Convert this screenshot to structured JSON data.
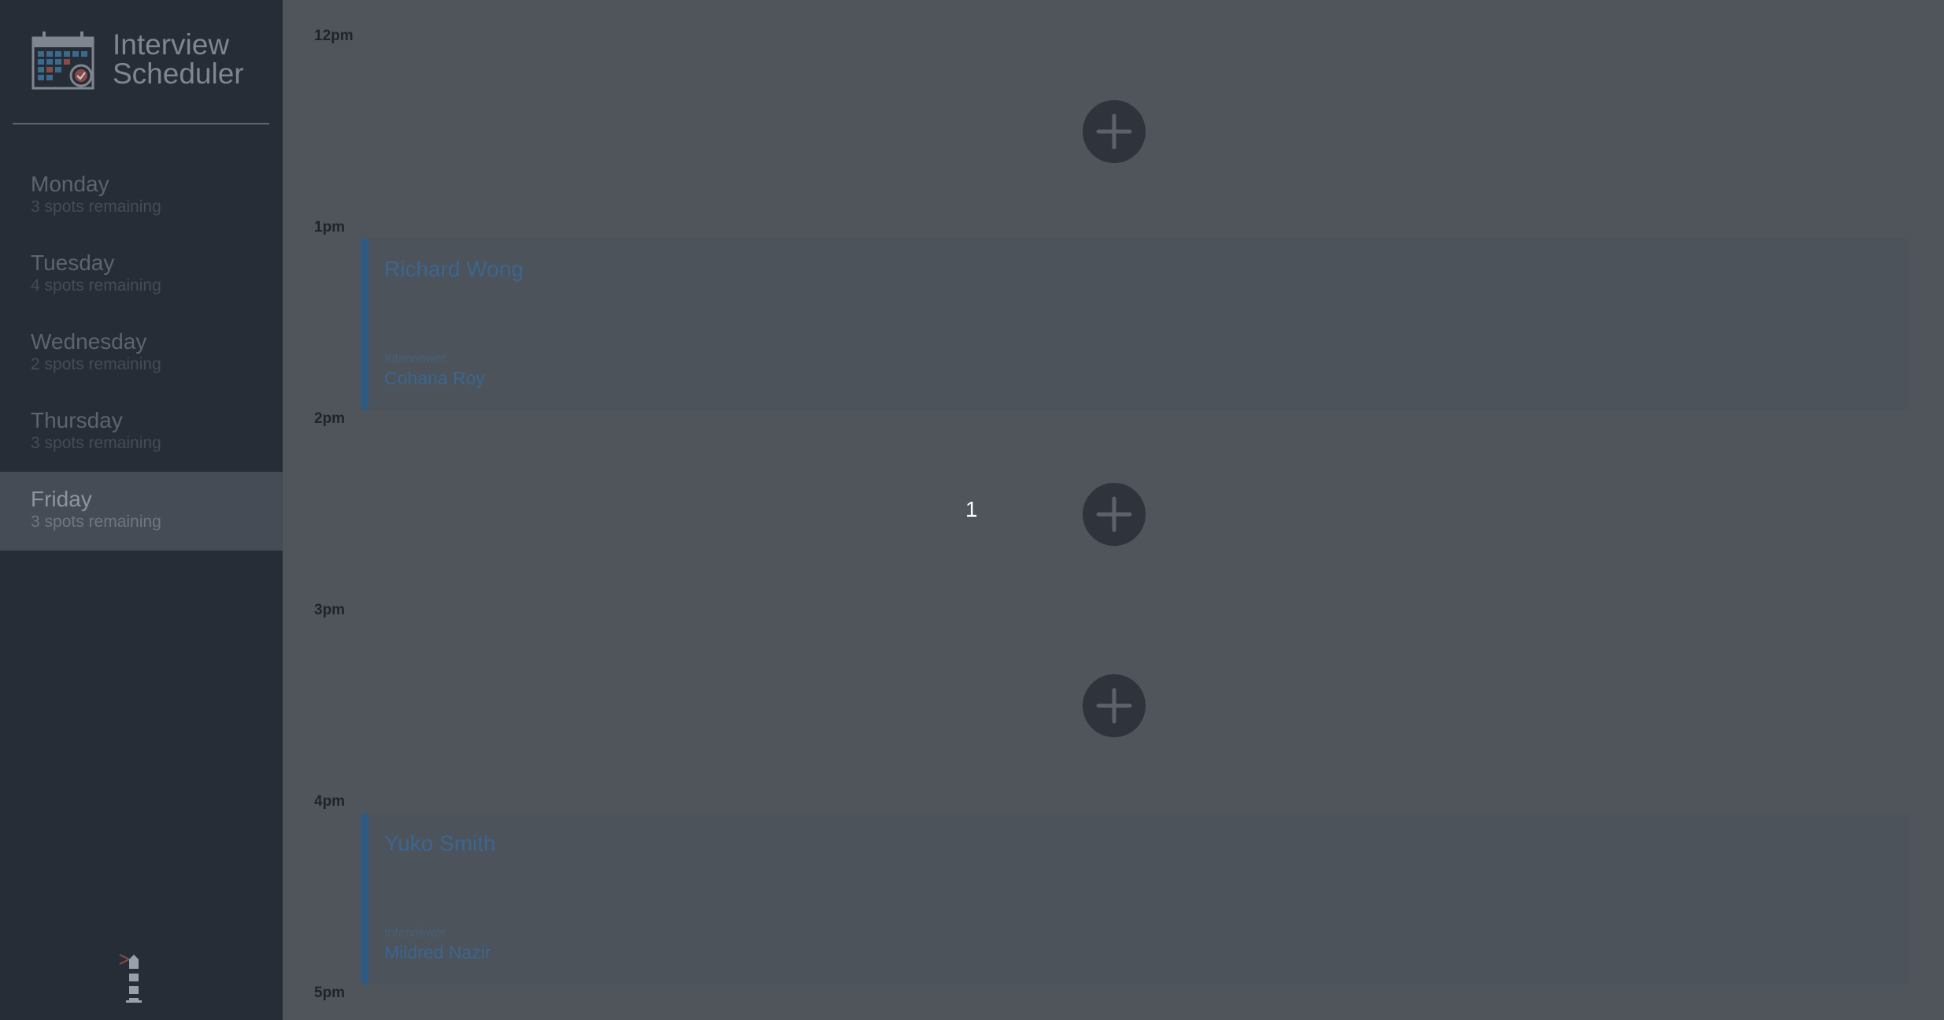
{
  "brand": {
    "title_line1": "Interview",
    "title_line2": "Scheduler",
    "logo_icon": "calendar-icon"
  },
  "days": [
    {
      "name": "Monday",
      "spots": "3 spots remaining",
      "selected": false
    },
    {
      "name": "Tuesday",
      "spots": "4 spots remaining",
      "selected": false
    },
    {
      "name": "Wednesday",
      "spots": "2 spots remaining",
      "selected": false
    },
    {
      "name": "Thursday",
      "spots": "3 spots remaining",
      "selected": false
    },
    {
      "name": "Friday",
      "spots": "3 spots remaining",
      "selected": true
    }
  ],
  "footer_icon": "lighthouse-icon",
  "schedule": {
    "slots": [
      {
        "time": "12pm",
        "status": "empty",
        "add_icon": "plus-icon"
      },
      {
        "time": "1pm",
        "status": "booked",
        "student": "Richard Wong",
        "interviewer_label": "Interviewer",
        "interviewer": "Cohana Roy"
      },
      {
        "time": "2pm",
        "status": "empty",
        "add_icon": "plus-icon"
      },
      {
        "time": "3pm",
        "status": "empty",
        "add_icon": "plus-icon"
      },
      {
        "time": "4pm",
        "status": "booked",
        "student": "Yuko Smith",
        "interviewer_label": "Interviewer",
        "interviewer": "Mildred Nazir"
      }
    ],
    "end_time": "5pm"
  },
  "overlay_number": "1",
  "colors": {
    "sidebar_bg": "#262d36",
    "main_bg": "#50555c",
    "selected_day_bg": "#454c55",
    "appointment_accent": "#2e5a82",
    "add_button_bg": "#2f343c"
  }
}
